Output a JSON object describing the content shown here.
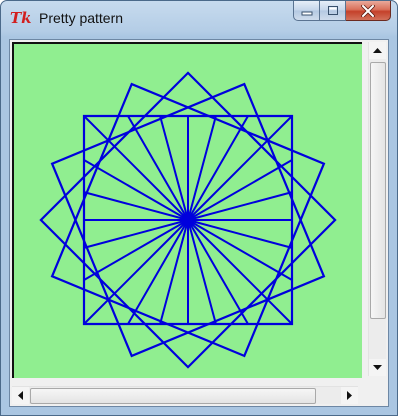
{
  "window": {
    "title": "Pretty pattern",
    "app_icon": "tk-feather-icon",
    "app_icon_text": "Tk"
  },
  "caption_buttons": {
    "minimize": "minimize-icon",
    "maximize": "maximize-icon",
    "close": "close-icon"
  },
  "canvas": {
    "background": "#90ee90",
    "stroke_color": "#0000dd",
    "pattern": "rotated-squares",
    "square_count": 4,
    "rotation_step_degrees": 22.5,
    "spoke_count": 24
  },
  "scrollbars": {
    "vertical": {
      "up_icon": "arrow-up-icon",
      "down_icon": "arrow-down-icon"
    },
    "horizontal": {
      "left_icon": "arrow-left-icon",
      "right_icon": "arrow-right-icon"
    }
  }
}
